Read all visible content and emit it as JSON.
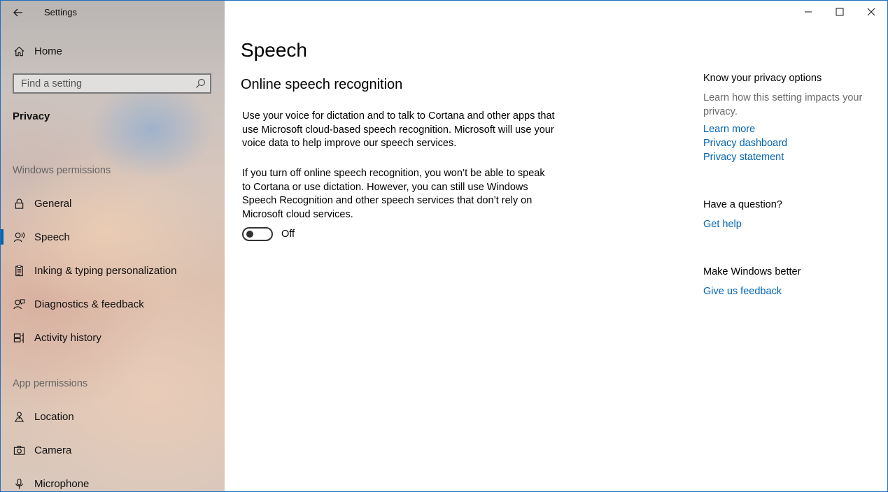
{
  "window": {
    "app_title": "Settings"
  },
  "sidebar": {
    "home_label": "Home",
    "search_placeholder": "Find a setting",
    "category": "Privacy",
    "sections": {
      "windows_permissions": "Windows permissions",
      "app_permissions": "App permissions"
    },
    "windows_items": [
      {
        "label": "General",
        "icon": "lock-icon"
      },
      {
        "label": "Speech",
        "icon": "speech-icon",
        "selected": true
      },
      {
        "label": "Inking & typing personalization",
        "icon": "clipboard-icon"
      },
      {
        "label": "Diagnostics & feedback",
        "icon": "person-feedback-icon"
      },
      {
        "label": "Activity history",
        "icon": "timeline-icon"
      }
    ],
    "app_items": [
      {
        "label": "Location",
        "icon": "location-icon"
      },
      {
        "label": "Camera",
        "icon": "camera-icon"
      },
      {
        "label": "Microphone",
        "icon": "microphone-icon"
      }
    ]
  },
  "main": {
    "title": "Speech",
    "subtitle": "Online speech recognition",
    "paragraph1": "Use your voice for dictation and to talk to Cortana and other apps that use Microsoft cloud-based speech recognition. Microsoft will use your voice data to help improve our speech services.",
    "paragraph2": "If you turn off online speech recognition, you won’t be able to speak to Cortana or use dictation. However, you can still use Windows Speech Recognition and other speech services that don’t rely on Microsoft cloud services.",
    "toggle": {
      "state_label": "Off",
      "on": false
    }
  },
  "right": {
    "privacy_heading": "Know your privacy options",
    "privacy_text": "Learn how this setting impacts your privacy.",
    "links": [
      "Learn more",
      "Privacy dashboard",
      "Privacy statement"
    ],
    "question_heading": "Have a question?",
    "help_link": "Get help",
    "better_heading": "Make Windows better",
    "feedback_link": "Give us feedback"
  },
  "colors": {
    "accent": "#0063b1",
    "border": "#1e6fbf"
  }
}
